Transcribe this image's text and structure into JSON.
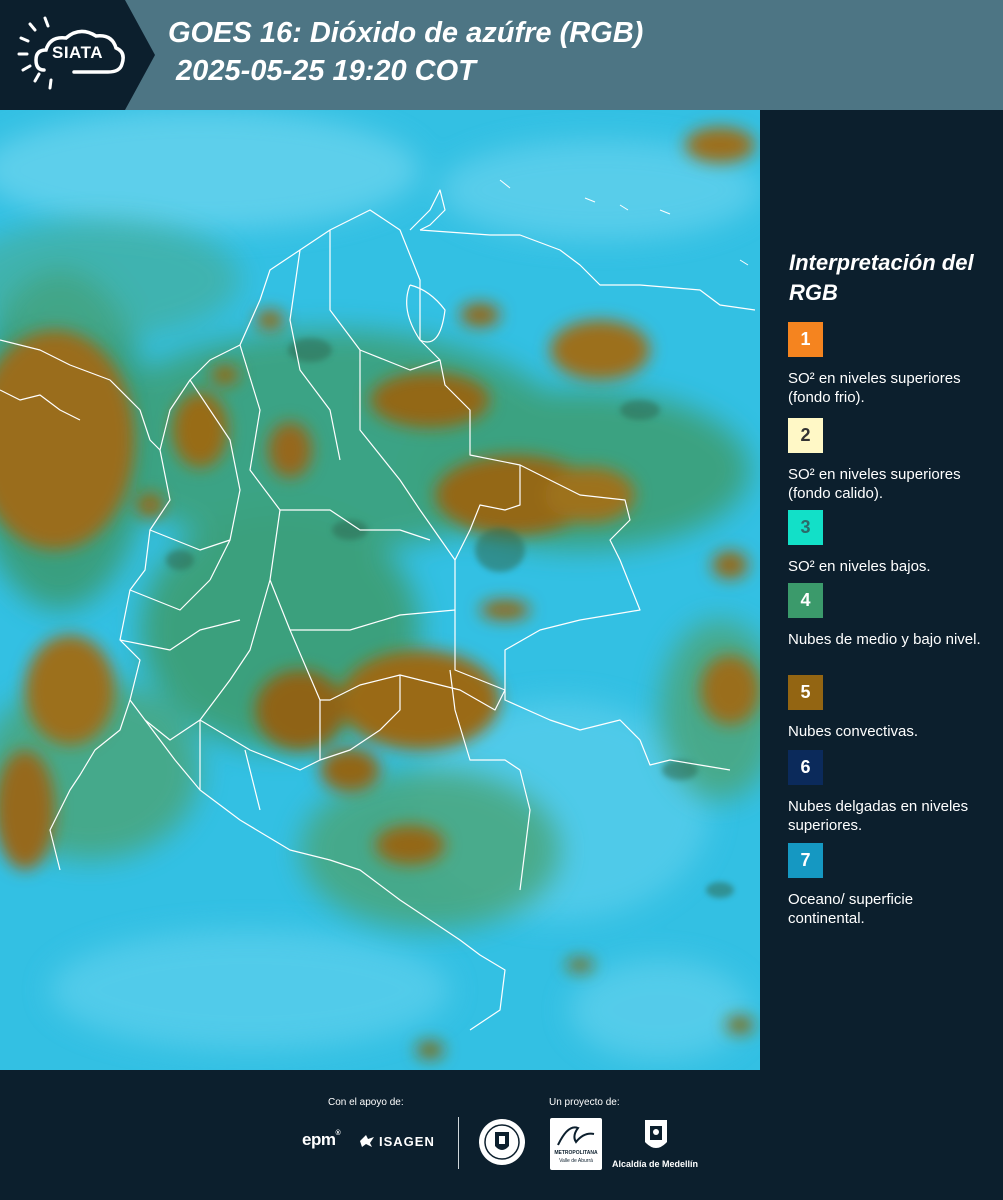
{
  "header": {
    "logo_text": "SIATA",
    "title_line1": "GOES 16: Dióxido de azúfre (RGB)",
    "title_line2": " 2025-05-25 19:20 COT"
  },
  "map": {
    "icon": "satellite-rgb-composite",
    "background_color": "#35c1e4",
    "border_color": "#ffffff"
  },
  "legend": {
    "title": "Interpretación del RGB",
    "items": [
      {
        "number": "1",
        "color": "#f5841f",
        "text": "SO² en niveles superiores (fondo frio)."
      },
      {
        "number": "2",
        "color": "#fff8c6",
        "text": "SO² en niveles superiores (fondo calido)."
      },
      {
        "number": "3",
        "color": "#12e0c8",
        "text": "SO² en niveles bajos."
      },
      {
        "number": "4",
        "color": "#3b9a6b",
        "text": "Nubes de medio y bajo nivel."
      },
      {
        "number": "5",
        "color": "#936512",
        "text": "Nubes convectivas."
      },
      {
        "number": "6",
        "color": "#0b2a5b",
        "text": "Nubes delgadas en niveles superiores."
      },
      {
        "number": "7",
        "color": "#1598c2",
        "text": "Oceano/ superficie continental."
      }
    ]
  },
  "footer": {
    "support_label": "Con el apoyo de:",
    "project_label": "Un proyecto de:",
    "epm": "epm",
    "isagen": "ISAGEN",
    "area_metro_line1": "METROPOLITANA",
    "area_metro_line2": "Valle de Aburrá",
    "alcaldia": "Alcaldía de Medellín"
  }
}
